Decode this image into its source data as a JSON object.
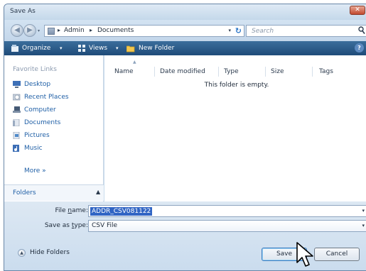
{
  "window": {
    "title": "Save As",
    "close_glyph": "✕"
  },
  "navigation": {
    "back_glyph": "◀",
    "forward_glyph": "▶",
    "address": {
      "crumbs": [
        "Admin",
        "Documents"
      ],
      "separator": "▸"
    },
    "refresh_glyph": "↻",
    "search_placeholder": "Search"
  },
  "toolbar": {
    "organize_label": "Organize",
    "views_label": "Views",
    "new_folder_label": "New Folder",
    "dropdown_glyph": "▾",
    "help_glyph": "?"
  },
  "sidebar": {
    "heading": "Favorite Links",
    "items": [
      {
        "label": "Desktop",
        "icon": "desktop-icon"
      },
      {
        "label": "Recent Places",
        "icon": "recent-places-icon"
      },
      {
        "label": "Computer",
        "icon": "computer-icon"
      },
      {
        "label": "Documents",
        "icon": "documents-icon"
      },
      {
        "label": "Pictures",
        "icon": "pictures-icon"
      },
      {
        "label": "Music",
        "icon": "music-icon"
      }
    ],
    "more_label": "More »",
    "folders_label": "Folders",
    "folders_chevron": "▲"
  },
  "file_list": {
    "columns": [
      "Name",
      "Date modified",
      "Type",
      "Size",
      "Tags"
    ],
    "empty_message": "This folder is empty."
  },
  "save_form": {
    "filename_label_pre": "File ",
    "filename_label_key": "n",
    "filename_label_post": "ame:",
    "filename_value": "ADDR_CSV081122",
    "filetype_label_pre": "Save as ",
    "filetype_label_key": "t",
    "filetype_label_post": "ype:",
    "filetype_value": "CSV File"
  },
  "footer": {
    "hide_folders_label": "Hide Folders",
    "save_label": "Save",
    "cancel_label": "Cancel"
  },
  "colors": {
    "toolbar": "#1f4b79",
    "link": "#1f5fa6",
    "selection": "#3165c4"
  }
}
